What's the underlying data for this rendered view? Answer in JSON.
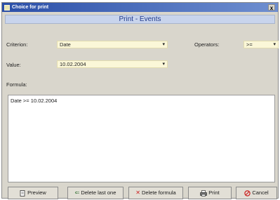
{
  "window": {
    "title": "Choice for print",
    "close_glyph": "x"
  },
  "header": {
    "text": "Print - Events"
  },
  "criterion": {
    "label": "Criterion:",
    "value": "Date"
  },
  "operators": {
    "label": "Operators:",
    "value": ">="
  },
  "value_field": {
    "label": "Value:",
    "value": "10.02.2004"
  },
  "formula": {
    "label": "Formula:",
    "text": "Date >= 10.02.2004"
  },
  "dropdown_arrow": "▾",
  "buttons": {
    "preview": {
      "label": "Preview",
      "icon": "preview-icon"
    },
    "delete_last": {
      "label": "Delete last one",
      "icon": "arrow-left-icon"
    },
    "delete_formula": {
      "label": "Delete formula",
      "icon": "delete-x-icon"
    },
    "print": {
      "label": "Print",
      "icon": "printer-icon"
    },
    "cancel": {
      "label": "Cancel",
      "icon": "cancel-icon"
    }
  },
  "colors": {
    "titlebar": "#2b4fa8",
    "header_band": "#c8d4ec",
    "field_bg": "#fbf7d8",
    "delete_red": "#cc2020"
  }
}
